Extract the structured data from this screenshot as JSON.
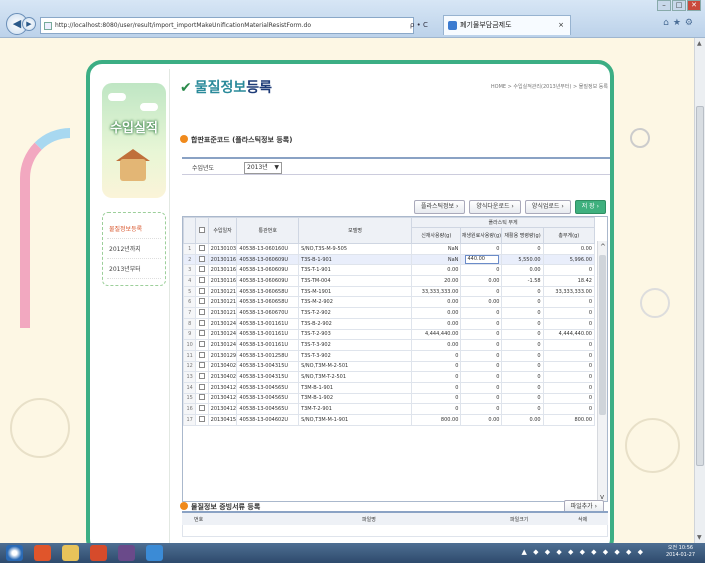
{
  "browser": {
    "url": "http://localhost:8080/user/result/import_importMakeUnificationMaterialResistForm.do",
    "search_icon_label": "ρ • C",
    "tab_title": "폐기물부담금제도",
    "tab_close": "×"
  },
  "sidebar": {
    "title": "수입실적",
    "items": [
      {
        "label": "물질정보등록"
      },
      {
        "label": "2012년까지"
      },
      {
        "label": "2013년부터"
      }
    ]
  },
  "page": {
    "title_a": "물질정보",
    "title_b": "등록",
    "breadcrumb": "HOME > 수입실적관리(2013년부터) > 물질정보 등록"
  },
  "section1": {
    "title": "합판표준코드 (플라스틱정보 등록)",
    "year_label": "수입년도",
    "year_value": "2013년"
  },
  "buttons": {
    "plastic": "플라스틱정보 ›",
    "excel_down": "양식다운로드 ›",
    "excel_up": "양식업로드 ›",
    "save_small": "저 장 ›",
    "add_file": "파일추가 ›",
    "save": "저 장"
  },
  "table": {
    "h_date": "수입일자",
    "h_decl": "통관번호",
    "h_model": "모델명",
    "h_plastic": "플라스틱 무게",
    "h_new": "신재사용량(g)",
    "h_recycle": "재생원료사용량(g)",
    "h_exempt": "재활용 명령량(g)",
    "h_total": "총무게(g)",
    "rows": [
      {
        "n": "1",
        "date": "20130103",
        "decl": "40538-13-060160U",
        "model": "S/NO,T3S-M-9-505",
        "new": "NaN",
        "rec": "0",
        "ex": "0",
        "tot": "0.00"
      },
      {
        "n": "2",
        "date": "20130116",
        "decl": "40538-13-060609U",
        "model": "T3S-B-1-901",
        "new": "NaN",
        "rec": "440.00",
        "ex": "5,550.00",
        "tot": "5,996.00"
      },
      {
        "n": "3",
        "date": "20130116",
        "decl": "40538-13-060609U",
        "model": "T3S-T-1-901",
        "new": "0.00",
        "rec": "0",
        "ex": "0.00",
        "tot": "0"
      },
      {
        "n": "4",
        "date": "20130116",
        "decl": "40538-13-060609U",
        "model": "T3S-TM-004",
        "new": "20.00",
        "rec": "0.00",
        "ex": "-1.58",
        "tot": "18.42"
      },
      {
        "n": "5",
        "date": "20130121",
        "decl": "40538-13-060658U",
        "model": "T3S-M-1901",
        "new": "33,333,333.00",
        "rec": "0",
        "ex": "0",
        "tot": "33,333,333.00"
      },
      {
        "n": "6",
        "date": "20130121",
        "decl": "40538-13-060658U",
        "model": "T3S-M-2-902",
        "new": "0.00",
        "rec": "0.00",
        "ex": "0",
        "tot": "0"
      },
      {
        "n": "7",
        "date": "20130121",
        "decl": "40538-13-060670U",
        "model": "T3S-T-2-902",
        "new": "0.00",
        "rec": "0",
        "ex": "0",
        "tot": "0"
      },
      {
        "n": "8",
        "date": "20130124",
        "decl": "40538-13-001161U",
        "model": "T3S-B-2-902",
        "new": "0.00",
        "rec": "0",
        "ex": "0",
        "tot": "0"
      },
      {
        "n": "9",
        "date": "20130124",
        "decl": "40538-13-001161U",
        "model": "T3S-T-2-903",
        "new": "4,444,440.00",
        "rec": "0",
        "ex": "0",
        "tot": "4,444,440.00"
      },
      {
        "n": "10",
        "date": "20130124",
        "decl": "40538-13-001161U",
        "model": "T3S-T-3-902",
        "new": "0.00",
        "rec": "0",
        "ex": "0",
        "tot": "0"
      },
      {
        "n": "11",
        "date": "20130129",
        "decl": "40538-13-001258U",
        "model": "T3S-T-3-902",
        "new": "0",
        "rec": "0",
        "ex": "0",
        "tot": "0"
      },
      {
        "n": "12",
        "date": "20130402",
        "decl": "40538-13-004315U",
        "model": "S/NO,T3M-M-2-501",
        "new": "0",
        "rec": "0",
        "ex": "0",
        "tot": "0"
      },
      {
        "n": "13",
        "date": "20130402",
        "decl": "40538-13-004315U",
        "model": "S/NO,T3M-T-2-501",
        "new": "0",
        "rec": "0",
        "ex": "0",
        "tot": "0"
      },
      {
        "n": "14",
        "date": "20130412",
        "decl": "40538-13-004565U",
        "model": "T3M-B-1-901",
        "new": "0",
        "rec": "0",
        "ex": "0",
        "tot": "0"
      },
      {
        "n": "15",
        "date": "20130412",
        "decl": "40538-13-004565U",
        "model": "T3M-B-1-902",
        "new": "0",
        "rec": "0",
        "ex": "0",
        "tot": "0"
      },
      {
        "n": "16",
        "date": "20130412",
        "decl": "40538-13-004565U",
        "model": "T3M-T-2-901",
        "new": "0",
        "rec": "0",
        "ex": "0",
        "tot": "0"
      },
      {
        "n": "17",
        "date": "20130415",
        "decl": "40538-13-004602U",
        "model": "S/NO,T3M-M-1-901",
        "new": "800.00",
        "rec": "0.00",
        "ex": "0.00",
        "tot": "800.00"
      }
    ]
  },
  "section2": {
    "title": "물질정보 증빙서류 등록",
    "h_no": "번호",
    "h_file": "파일명",
    "h_size": "파일크기",
    "h_del": "삭제"
  },
  "taskbar": {
    "clock_time": "오전 10:56",
    "clock_date": "2014-01-27"
  }
}
